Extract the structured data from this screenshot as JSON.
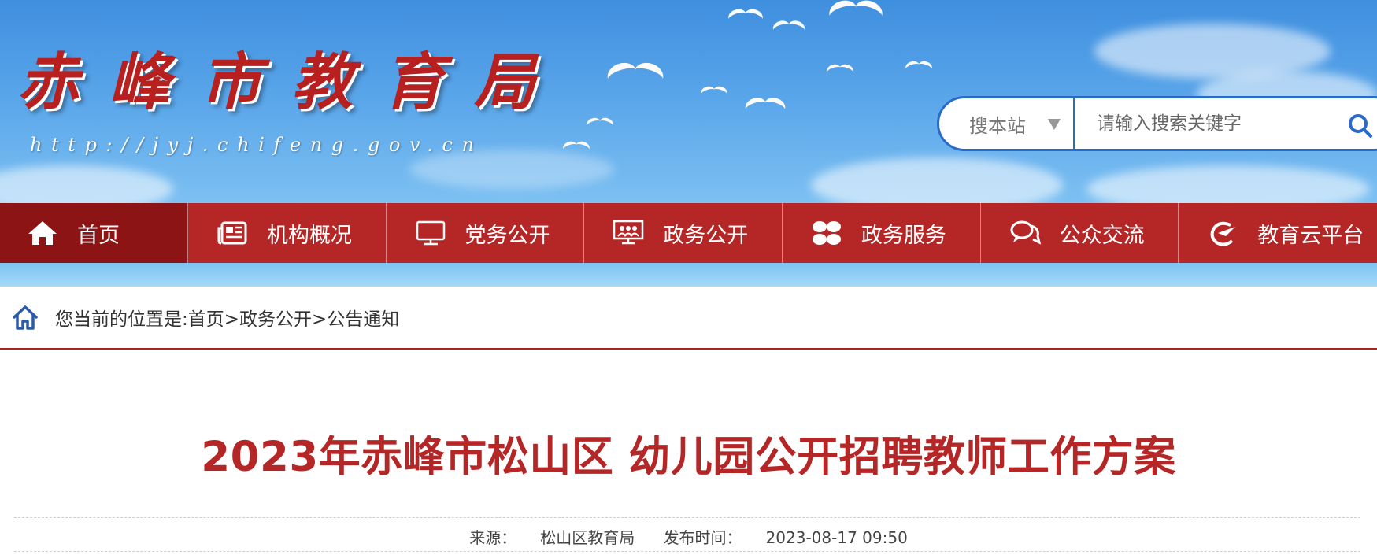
{
  "header": {
    "site_title": "赤峰市教育局",
    "site_url": "http://jyj.chifeng.gov.cn",
    "search": {
      "scope": "搜本站",
      "placeholder": "请输入搜索关键字"
    }
  },
  "nav": {
    "items": [
      {
        "label": "首页",
        "icon": "home-icon"
      },
      {
        "label": "机构概况",
        "icon": "newspaper-icon"
      },
      {
        "label": "党务公开",
        "icon": "monitor-icon"
      },
      {
        "label": "政务公开",
        "icon": "presentation-icon"
      },
      {
        "label": "政务服务",
        "icon": "grid-icon"
      },
      {
        "label": "公众交流",
        "icon": "chat-bubbles-icon"
      },
      {
        "label": "教育云平台",
        "icon": "edu-cloud-icon"
      }
    ]
  },
  "breadcrumb": {
    "prefix": "您当前的位置是:",
    "items": [
      "首页",
      "政务公开",
      "公告通知"
    ],
    "separator": ">"
  },
  "article": {
    "title": "2023年赤峰市松山区 幼儿园公开招聘教师工作方案",
    "source_label": "来源：",
    "source": "松山区教育局",
    "publish_label": "发布时间：",
    "publish_time": "2023-08-17 09:50"
  },
  "colors": {
    "brand_red": "#b52626",
    "nav_active": "#8c1414",
    "search_border": "#2a6bc8",
    "sky": "#5aa6ea"
  }
}
